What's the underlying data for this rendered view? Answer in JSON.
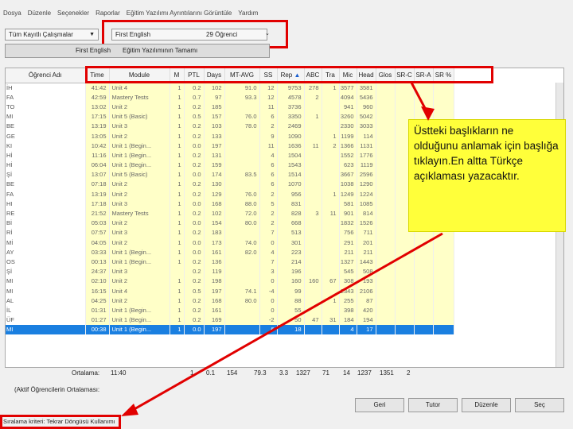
{
  "menu": [
    "Dosya",
    "Düzenle",
    "Seçenekler",
    "Raporlar",
    "Eğitim Yazılımı Ayrıntılarını Görüntüle",
    "Yardım"
  ],
  "top": {
    "left_dropdown": "Tüm Kayıtlı Çalışmalar",
    "class_dropdown": "First English",
    "class_count": "29 Öğrenci"
  },
  "subtitle": {
    "class": "First English",
    "curriculum": "Eğitim Yazılımının Tamamı"
  },
  "columns": [
    "Öğrenci Adı",
    "Time",
    "Module",
    "M",
    "PTL",
    "Days",
    "MT-AVG",
    "SS",
    "Rep",
    "ABC",
    "Tra",
    "Mic",
    "Head",
    "Glos",
    "SR-C",
    "SR-A",
    "SR %"
  ],
  "rows": [
    {
      "name": "İH",
      "c": [
        "41:42",
        "Unit 4",
        "1",
        "0.2",
        "102",
        "91.0",
        "12",
        "9753",
        "278",
        "1",
        "3577",
        "3581",
        "",
        "",
        "",
        ""
      ]
    },
    {
      "name": "FA",
      "c": [
        "42:59",
        "Mastery Tests",
        "1",
        "0.7",
        "97",
        "93.3",
        "12",
        "4578",
        "2",
        "",
        "4094",
        "5436",
        "",
        "",
        "",
        ""
      ]
    },
    {
      "name": "TO",
      "c": [
        "13:02",
        "Unit 2",
        "1",
        "0.2",
        "185",
        "",
        "11",
        "3736",
        "",
        "",
        "941",
        "960",
        "",
        "",
        "",
        ""
      ]
    },
    {
      "name": "MI",
      "c": [
        "17:15",
        "Unit 5 (Basic)",
        "1",
        "0.5",
        "157",
        "76.0",
        "6",
        "3350",
        "1",
        "",
        "3260",
        "5042",
        "",
        "",
        "",
        ""
      ]
    },
    {
      "name": "BE",
      "c": [
        "13:19",
        "Unit 3",
        "1",
        "0.2",
        "103",
        "78.0",
        "2",
        "2469",
        "",
        "",
        "2330",
        "3033",
        "",
        "",
        "",
        ""
      ]
    },
    {
      "name": "GE",
      "c": [
        "13:05",
        "Unit 2",
        "1",
        "0.2",
        "133",
        "",
        "9",
        "1090",
        "",
        "1",
        "1199",
        "114",
        "",
        "",
        "",
        ""
      ]
    },
    {
      "name": "KI",
      "c": [
        "10:42",
        "Unit 1 (Begin...",
        "1",
        "0.0",
        "197",
        "",
        "11",
        "1636",
        "11",
        "2",
        "1366",
        "1131",
        "",
        "",
        "",
        ""
      ]
    },
    {
      "name": "Hİ",
      "c": [
        "11:16",
        "Unit 1 (Begin...",
        "1",
        "0.2",
        "131",
        "",
        "4",
        "1504",
        "",
        "",
        "1552",
        "1776",
        "",
        "",
        "",
        ""
      ]
    },
    {
      "name": "Hİ",
      "c": [
        "06:04",
        "Unit 1 (Begin...",
        "1",
        "0.2",
        "159",
        "",
        "6",
        "1543",
        "",
        "",
        "623",
        "1119",
        "",
        "",
        "",
        ""
      ]
    },
    {
      "name": "Şİ",
      "c": [
        "13:07",
        "Unit 5 (Basic)",
        "1",
        "0.0",
        "174",
        "83.5",
        "6",
        "1514",
        "",
        "",
        "3667",
        "2596",
        "",
        "",
        "",
        ""
      ]
    },
    {
      "name": "BE",
      "c": [
        "07:18",
        "Unit 2",
        "1",
        "0.2",
        "130",
        "",
        "6",
        "1070",
        "",
        "",
        "1038",
        "1290",
        "",
        "",
        "",
        ""
      ]
    },
    {
      "name": "FA",
      "c": [
        "13:19",
        "Unit 2",
        "1",
        "0.2",
        "129",
        "76.0",
        "2",
        "956",
        "",
        "1",
        "1249",
        "1224",
        "",
        "",
        "",
        ""
      ]
    },
    {
      "name": "HI",
      "c": [
        "17:18",
        "Unit 3",
        "1",
        "0.0",
        "168",
        "88.0",
        "5",
        "831",
        "",
        "",
        "581",
        "1085",
        "",
        "",
        "",
        ""
      ]
    },
    {
      "name": "RE",
      "c": [
        "21:52",
        "Mastery Tests",
        "1",
        "0.2",
        "102",
        "72.0",
        "2",
        "828",
        "3",
        "11",
        "901",
        "814",
        "",
        "",
        "",
        ""
      ]
    },
    {
      "name": "Bİ",
      "c": [
        "05:03",
        "Unit 2",
        "1",
        "0.0",
        "154",
        "80.0",
        "2",
        "668",
        "",
        "",
        "1832",
        "1526",
        "",
        "",
        "",
        ""
      ]
    },
    {
      "name": "Rİ",
      "c": [
        "07:57",
        "Unit 3",
        "1",
        "0.2",
        "183",
        "",
        "7",
        "513",
        "",
        "",
        "756",
        "711",
        "",
        "",
        "",
        ""
      ]
    },
    {
      "name": "Mİ",
      "c": [
        "04:05",
        "Unit 2",
        "1",
        "0.0",
        "173",
        "74.0",
        "0",
        "301",
        "",
        "",
        "291",
        "201",
        "",
        "",
        "",
        ""
      ]
    },
    {
      "name": "AY",
      "c": [
        "03:33",
        "Unit 1 (Begin...",
        "1",
        "0.0",
        "161",
        "82.0",
        "4",
        "223",
        "",
        "",
        "211",
        "211",
        "",
        "",
        "",
        ""
      ]
    },
    {
      "name": "OS",
      "c": [
        "00:13",
        "Unit 1 (Begin...",
        "1",
        "0.2",
        "136",
        "",
        "7",
        "214",
        "",
        "",
        "1327",
        "1443",
        "",
        "",
        "",
        ""
      ]
    },
    {
      "name": "Şİ",
      "c": [
        "24:37",
        "Unit 3",
        "",
        "0.2",
        "119",
        "",
        "3",
        "196",
        "",
        "",
        "545",
        "508",
        "",
        "",
        "",
        ""
      ]
    },
    {
      "name": "MI",
      "c": [
        "02:10",
        "Unit 2",
        "1",
        "0.2",
        "198",
        "",
        "0",
        "160",
        "160",
        "67",
        "308",
        "193",
        "",
        "",
        "",
        ""
      ]
    },
    {
      "name": "MI",
      "c": [
        "16:15",
        "Unit 4",
        "1",
        "0.5",
        "197",
        "74.1",
        "-4",
        "99",
        "",
        "",
        "2343",
        "2106",
        "",
        "",
        "",
        ""
      ]
    },
    {
      "name": "AL",
      "c": [
        "04:25",
        "Unit 2",
        "1",
        "0.2",
        "168",
        "80.0",
        "0",
        "88",
        "",
        "1",
        "255",
        "87",
        "",
        "",
        "",
        ""
      ]
    },
    {
      "name": "İL",
      "c": [
        "01:31",
        "Unit 1 (Begin...",
        "1",
        "0.2",
        "161",
        "",
        "0",
        "55",
        "",
        "",
        "398",
        "420",
        "",
        "",
        "",
        ""
      ]
    },
    {
      "name": "ÜF",
      "c": [
        "01:27",
        "Unit 1 (Begin...",
        "1",
        "0.2",
        "169",
        "",
        "-2",
        "50",
        "47",
        "31",
        "184",
        "194",
        "",
        "",
        "",
        ""
      ]
    },
    {
      "name": "MI",
      "c": [
        "00:38",
        "Unit 1 (Begin...",
        "1",
        "0.0",
        "197",
        "",
        "6",
        "18",
        "",
        "",
        "4",
        "17",
        "",
        "",
        "",
        ""
      ],
      "selected": true
    }
  ],
  "averages": {
    "label": "Ortalama:",
    "time": "11:40",
    "m": "1",
    "ptl": "0.1",
    "days": "154",
    "mtavg": "79.3",
    "ss": "3.3",
    "rep": "1327",
    "abc": "71",
    "tra": "14",
    "mic": "1237",
    "head": "1351",
    "glos": "2"
  },
  "active_avg_label": "(Aktif Öğrencilerin Ortalaması:",
  "buttons": [
    "Geri",
    "Tutor",
    "Düzenle",
    "Seç"
  ],
  "footer": "Sıralama kriteri: Tekrar Döngüsü Kullanımı",
  "callout": "Üstteki başlıkların ne olduğunu anlamak için başlığa tıklayın.En altta Türkçe açıklaması yazacaktır.",
  "colors": {
    "highlight": "#e10000",
    "data_bg": "#ffffc8",
    "selection": "#1a7fe0",
    "callout_bg": "#ffff3a"
  },
  "icons": {
    "sort": "triangle-up-icon"
  }
}
